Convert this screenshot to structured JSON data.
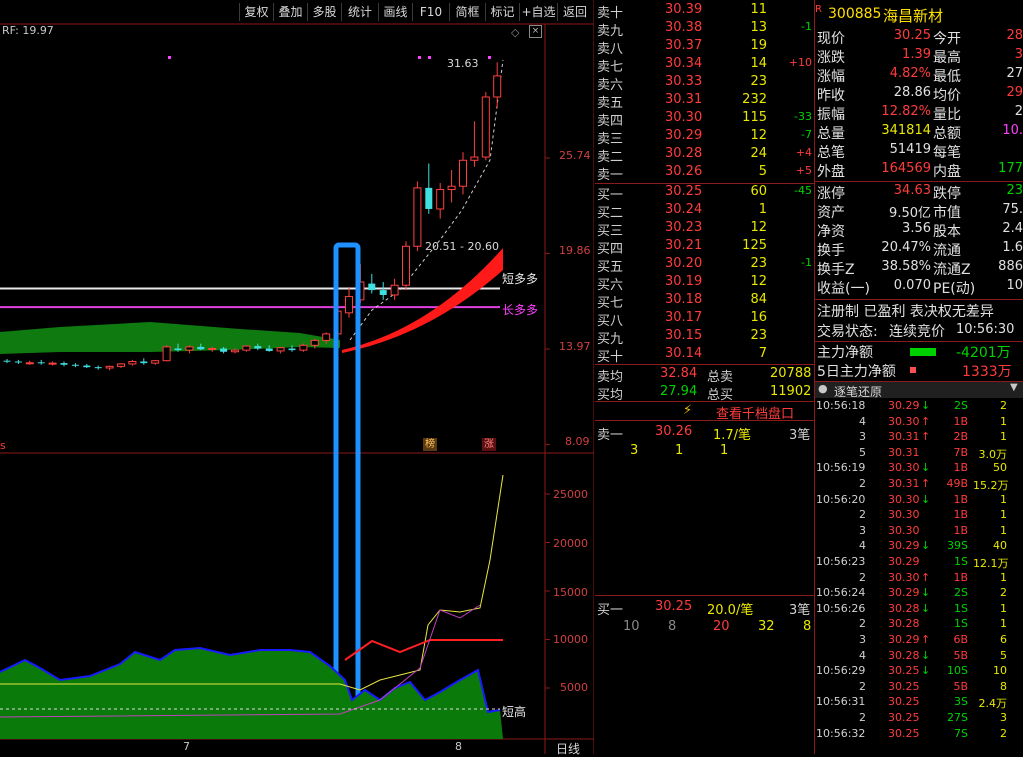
{
  "toolbar": {
    "buttons": [
      "复权",
      "叠加",
      "多股",
      "统计",
      "画线",
      "F10",
      "简框",
      "标记",
      "+自选",
      "返回"
    ]
  },
  "kline": {
    "indicator_label": "RF: 19.97",
    "peak_label": "31.63",
    "range_label": "20.51 - 20.60",
    "short_line_label": "短多多",
    "long_line_label": "长多多",
    "price_ticks": [
      "25.74",
      "19.86",
      "13.97",
      "8.09"
    ],
    "badge_left": "s",
    "badge_list": "榜",
    "badge_up": "涨"
  },
  "volume_panel": {
    "ticks": [
      "25000",
      "20000",
      "15000",
      "10000",
      "5000"
    ],
    "label_short_high": "短高",
    "xlabels": [
      "7",
      "8"
    ],
    "period_label": "日线"
  },
  "chart_data": {
    "type": "candlestick",
    "title": "",
    "ylabel": "",
    "y_ticks": [
      25.74,
      19.86,
      13.97,
      8.09
    ],
    "ylim": [
      8.09,
      33.5
    ],
    "series": [
      {
        "name": "K线",
        "ohlc": [
          [
            13.25,
            13.35,
            13.1,
            13.2
          ],
          [
            13.2,
            13.3,
            13.05,
            13.15
          ],
          [
            13.1,
            13.25,
            13.0,
            13.12
          ],
          [
            13.15,
            13.3,
            13.0,
            13.1
          ],
          [
            13.05,
            13.2,
            12.95,
            13.1
          ],
          [
            13.1,
            13.2,
            12.9,
            13.0
          ],
          [
            13.0,
            13.1,
            12.85,
            12.95
          ],
          [
            12.95,
            13.05,
            12.8,
            12.85
          ],
          [
            12.85,
            12.95,
            12.7,
            12.8
          ],
          [
            12.8,
            12.95,
            12.65,
            12.9
          ],
          [
            12.9,
            13.1,
            12.8,
            13.05
          ],
          [
            13.05,
            13.3,
            12.95,
            13.2
          ],
          [
            13.2,
            13.4,
            13.0,
            13.1
          ],
          [
            13.1,
            13.3,
            13.0,
            13.25
          ],
          [
            13.25,
            14.2,
            13.2,
            14.1
          ],
          [
            14.0,
            14.3,
            13.8,
            13.9
          ],
          [
            13.9,
            14.2,
            13.7,
            14.1
          ],
          [
            14.1,
            14.3,
            13.9,
            13.95
          ],
          [
            13.95,
            14.1,
            13.8,
            14.0
          ],
          [
            14.0,
            14.1,
            13.7,
            13.8
          ],
          [
            13.8,
            14.0,
            13.7,
            13.9
          ],
          [
            13.9,
            14.2,
            13.8,
            14.15
          ],
          [
            14.15,
            14.3,
            13.9,
            14.0
          ],
          [
            14.0,
            14.2,
            13.8,
            13.85
          ],
          [
            13.85,
            14.1,
            13.7,
            14.05
          ],
          [
            14.0,
            14.2,
            13.8,
            13.9
          ],
          [
            13.9,
            14.3,
            13.8,
            14.2
          ],
          [
            14.2,
            14.6,
            14.0,
            14.5
          ],
          [
            14.5,
            15.0,
            14.3,
            14.9
          ],
          [
            14.9,
            16.4,
            14.8,
            16.3
          ],
          [
            16.2,
            17.8,
            15.9,
            17.2
          ],
          [
            17.0,
            19.2,
            16.8,
            18.1
          ],
          [
            18.0,
            18.6,
            17.4,
            17.6
          ],
          [
            17.6,
            18.1,
            17.0,
            17.3
          ],
          [
            17.3,
            18.3,
            17.0,
            17.9
          ],
          [
            17.9,
            20.6,
            17.6,
            20.3
          ],
          [
            20.3,
            24.3,
            20.0,
            23.9
          ],
          [
            23.9,
            25.4,
            22.3,
            22.6
          ],
          [
            22.6,
            24.2,
            22.0,
            23.8
          ],
          [
            23.8,
            25.0,
            23.0,
            24.0
          ],
          [
            24.0,
            26.1,
            23.5,
            25.6
          ],
          [
            25.6,
            28.0,
            25.2,
            25.8
          ],
          [
            25.8,
            29.8,
            25.6,
            29.5
          ],
          [
            29.5,
            31.63,
            28.8,
            30.8
          ]
        ]
      },
      {
        "name": "短多多",
        "values": [
          17.7
        ]
      },
      {
        "name": "长多多",
        "values": [
          16.55
        ]
      }
    ],
    "volume_y_ticks": [
      25000,
      20000,
      15000,
      10000,
      5000
    ]
  },
  "quote": {
    "stock_code": "300885",
    "stock_name": "海昌新材",
    "r_flag": "R",
    "asks": [
      {
        "label": "卖十",
        "price": "30.39",
        "vol": "11",
        "chg": ""
      },
      {
        "label": "卖九",
        "price": "30.38",
        "vol": "13",
        "chg": "-1"
      },
      {
        "label": "卖八",
        "price": "30.37",
        "vol": "19",
        "chg": ""
      },
      {
        "label": "卖七",
        "price": "30.34",
        "vol": "14",
        "chg": "+10"
      },
      {
        "label": "卖六",
        "price": "30.33",
        "vol": "23",
        "chg": ""
      },
      {
        "label": "卖五",
        "price": "30.31",
        "vol": "232",
        "chg": ""
      },
      {
        "label": "卖四",
        "price": "30.30",
        "vol": "115",
        "chg": "-33"
      },
      {
        "label": "卖三",
        "price": "30.29",
        "vol": "12",
        "chg": "-7"
      },
      {
        "label": "卖二",
        "price": "30.28",
        "vol": "24",
        "chg": "+4"
      },
      {
        "label": "卖一",
        "price": "30.26",
        "vol": "5",
        "chg": "+5"
      }
    ],
    "bids": [
      {
        "label": "买一",
        "price": "30.25",
        "vol": "60",
        "chg": "-45"
      },
      {
        "label": "买二",
        "price": "30.24",
        "vol": "1",
        "chg": ""
      },
      {
        "label": "买三",
        "price": "30.23",
        "vol": "12",
        "chg": ""
      },
      {
        "label": "买四",
        "price": "30.21",
        "vol": "125",
        "chg": ""
      },
      {
        "label": "买五",
        "price": "30.20",
        "vol": "23",
        "chg": "-1"
      },
      {
        "label": "买六",
        "price": "30.19",
        "vol": "12",
        "chg": ""
      },
      {
        "label": "买七",
        "price": "30.18",
        "vol": "84",
        "chg": ""
      },
      {
        "label": "买八",
        "price": "30.17",
        "vol": "16",
        "chg": ""
      },
      {
        "label": "买九",
        "price": "30.15",
        "vol": "23",
        "chg": ""
      },
      {
        "label": "买十",
        "price": "30.14",
        "vol": "7",
        "chg": ""
      }
    ],
    "avg_sell_label": "卖均",
    "avg_sell": "32.84",
    "total_sell_label": "总卖",
    "total_sell": "20788",
    "avg_buy_label": "买均",
    "avg_buy": "27.94",
    "total_buy_label": "总买",
    "total_buy": "11902",
    "view_1000": "查看千档盘口",
    "sell1_label": "卖一",
    "sell1_price": "30.26",
    "sell1_avg": "1.7/笔",
    "sell1_count": "3笔",
    "sell1_queue": [
      "3",
      "1",
      "1"
    ],
    "buy1_label": "买一",
    "buy1_price": "30.25",
    "buy1_avg": "20.0/笔",
    "buy1_count": "3笔",
    "buy1_queue": [
      "10",
      "8",
      "20",
      "32",
      "8"
    ]
  },
  "stats": [
    {
      "k1": "现价",
      "v1": "30.25",
      "k2": "今开",
      "v2": "28"
    },
    {
      "k1": "涨跌",
      "v1": "1.39",
      "k2": "最高",
      "v2": "3"
    },
    {
      "k1": "涨幅",
      "v1": "4.82%",
      "k2": "最低",
      "v2": "27"
    },
    {
      "k1": "昨收",
      "v1": "28.86",
      "k2": "均价",
      "v2": "29"
    },
    {
      "k1": "振幅",
      "v1": "12.82%",
      "k2": "量比",
      "v2": "2"
    },
    {
      "k1": "总量",
      "v1": "341814",
      "k2": "总额",
      "v2": "10."
    },
    {
      "k1": "总笔",
      "v1": "51419",
      "k2": "每笔",
      "v2": ""
    },
    {
      "k1": "外盘",
      "v1": "164569",
      "k2": "内盘",
      "v2": "177"
    },
    {
      "k1": "涨停",
      "v1": "34.63",
      "k2": "跌停",
      "v2": "23"
    },
    {
      "k1": "资产",
      "v1": "9.50亿",
      "k2": "市值",
      "v2": "75."
    },
    {
      "k1": "净资",
      "v1": "3.56",
      "k2": "股本",
      "v2": "2.4"
    },
    {
      "k1": "换手",
      "v1": "20.47%",
      "k2": "流通",
      "v2": "1.6"
    },
    {
      "k1": "换手Z",
      "v1": "38.58%",
      "k2": "流通Z",
      "v2": "886"
    },
    {
      "k1": "收益(一)",
      "v1": "0.070",
      "k2": "PE(动)",
      "v2": "10"
    }
  ],
  "reg_info": "注册制 已盈利 表决权无差异",
  "trade_status_label": "交易状态:",
  "trade_status": "连续竞价",
  "trade_time": "10:56:30",
  "main_net_label": "主力净额",
  "main_net": "-4201万",
  "main_net5_label": "5日主力净额",
  "main_net5": "1333万",
  "ticks_header": "逐笔还原",
  "ticks": [
    {
      "t": "10:56:18",
      "p": "30.29",
      "d": "down",
      "v": "2S",
      "n": "2"
    },
    {
      "t": "4",
      "p": "30.30",
      "d": "up",
      "v": "1B",
      "n": "1"
    },
    {
      "t": "3",
      "p": "30.31",
      "d": "up",
      "v": "2B",
      "n": "1"
    },
    {
      "t": "5",
      "p": "30.31",
      "d": "",
      "v": "7B",
      "n": "3.0万"
    },
    {
      "t": "10:56:19",
      "p": "30.30",
      "d": "down",
      "v": "1B",
      "n": "50"
    },
    {
      "t": "2",
      "p": "30.31",
      "d": "up",
      "v": "49B",
      "n": "15.2万"
    },
    {
      "t": "10:56:20",
      "p": "30.30",
      "d": "down",
      "v": "1B",
      "n": "1"
    },
    {
      "t": "2",
      "p": "30.30",
      "d": "",
      "v": "1B",
      "n": "1"
    },
    {
      "t": "3",
      "p": "30.30",
      "d": "",
      "v": "1B",
      "n": "1"
    },
    {
      "t": "4",
      "p": "30.29",
      "d": "down",
      "v": "39S",
      "n": "40"
    },
    {
      "t": "10:56:23",
      "p": "30.29",
      "d": "",
      "v": "1S",
      "n": "12.1万"
    },
    {
      "t": "2",
      "p": "30.30",
      "d": "up",
      "v": "1B",
      "n": "1"
    },
    {
      "t": "10:56:24",
      "p": "30.29",
      "d": "down",
      "v": "2S",
      "n": "2"
    },
    {
      "t": "10:56:26",
      "p": "30.28",
      "d": "down",
      "v": "1S",
      "n": "1"
    },
    {
      "t": "2",
      "p": "30.28",
      "d": "",
      "v": "1S",
      "n": "1"
    },
    {
      "t": "3",
      "p": "30.29",
      "d": "up",
      "v": "6B",
      "n": "6"
    },
    {
      "t": "4",
      "p": "30.28",
      "d": "down",
      "v": "5B",
      "n": "5"
    },
    {
      "t": "10:56:29",
      "p": "30.25",
      "d": "down",
      "v": "10S",
      "n": "10"
    },
    {
      "t": "2",
      "p": "30.25",
      "d": "",
      "v": "5B",
      "n": "8"
    },
    {
      "t": "10:56:31",
      "p": "30.25",
      "d": "",
      "v": "3S",
      "n": "2.4万"
    },
    {
      "t": "2",
      "p": "30.25",
      "d": "",
      "v": "27S",
      "n": "3"
    },
    {
      "t": "10:56:32",
      "p": "30.25",
      "d": "",
      "v": "7S",
      "n": "2"
    }
  ]
}
